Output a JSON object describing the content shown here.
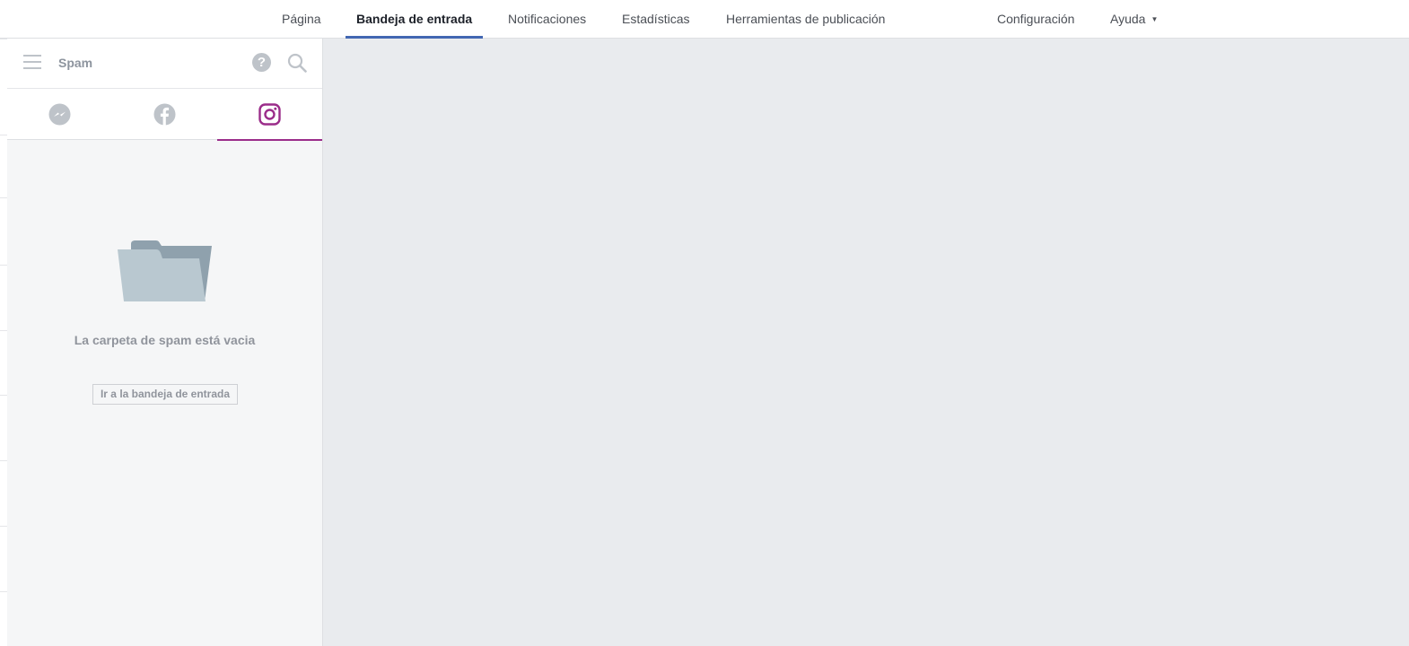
{
  "topnav": {
    "tabs": [
      {
        "label": "Página"
      },
      {
        "label": "Bandeja de entrada",
        "active": true
      },
      {
        "label": "Notificaciones"
      },
      {
        "label": "Estadísticas"
      },
      {
        "label": "Herramientas de publicación"
      }
    ],
    "settings_label": "Configuración",
    "help_label": "Ayuda",
    "accent_color": "#4267b2"
  },
  "sidebar": {
    "title": "Spam",
    "channels": [
      {
        "icon": "messenger-icon"
      },
      {
        "icon": "facebook-icon"
      },
      {
        "icon": "instagram-icon",
        "active": true
      }
    ],
    "instagram_color": "#9b2d8a",
    "empty_state": {
      "icon": "folder-icon",
      "message": "La carpeta de spam está vacia",
      "button_label": "Ir a la bandeja de entrada"
    }
  }
}
